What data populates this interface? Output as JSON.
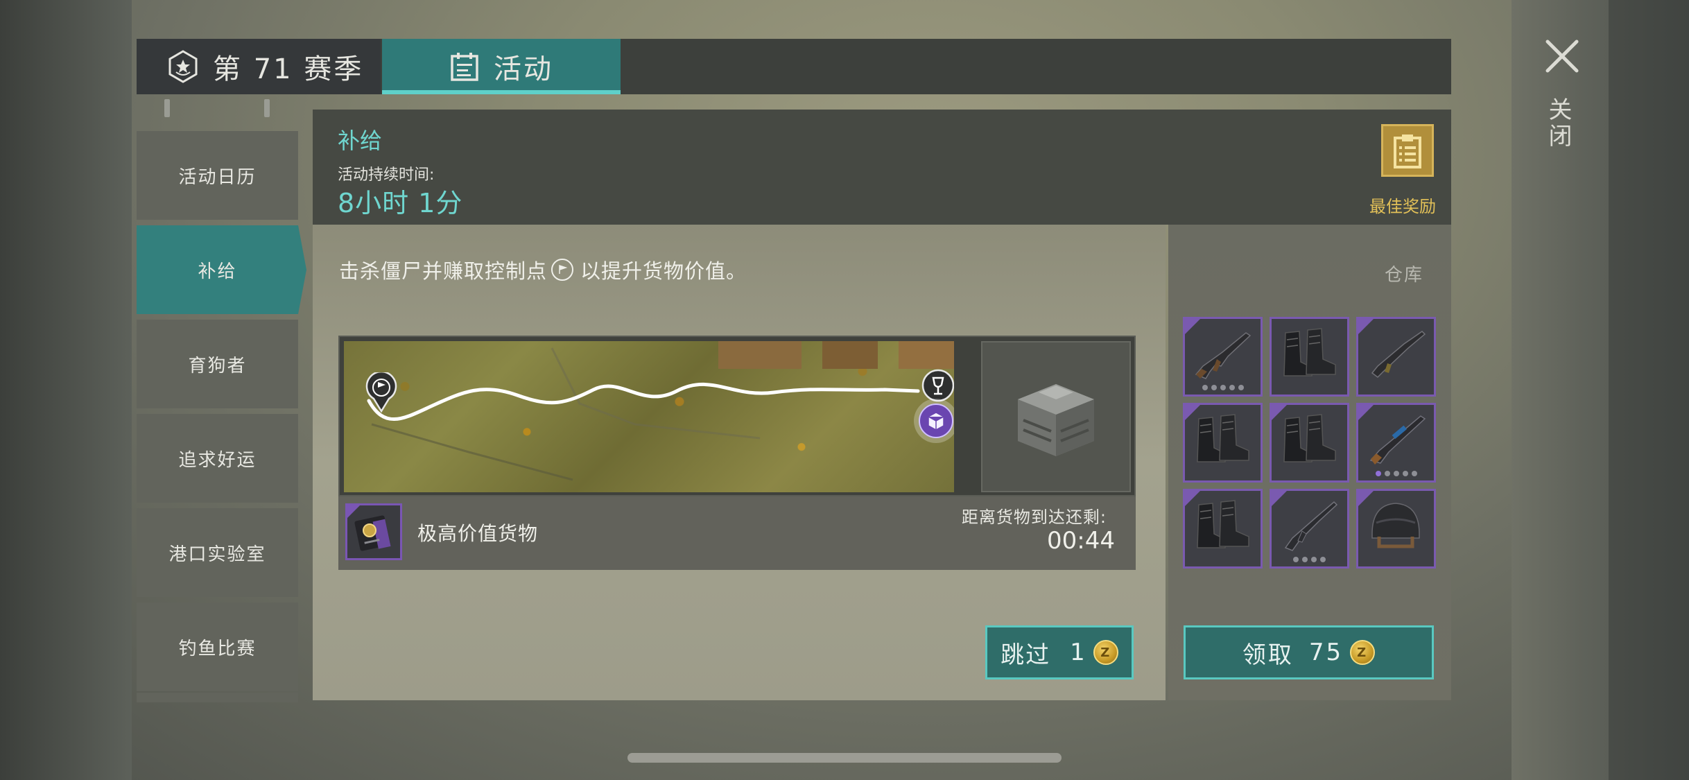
{
  "tabs": {
    "season": "第 71 赛季",
    "activity": "活动"
  },
  "sidebar": {
    "items": [
      {
        "label": "活动日历",
        "active": false
      },
      {
        "label": "补给",
        "active": true
      },
      {
        "label": "育狗者",
        "active": false
      },
      {
        "label": "追求好运",
        "active": false
      },
      {
        "label": "港口实验室",
        "active": false
      },
      {
        "label": "钓鱼比赛",
        "active": false
      }
    ]
  },
  "header": {
    "title": "补给",
    "duration_label": "活动持续时间:",
    "duration_value": "8小时 1分",
    "best_reward_label": "最佳奖励"
  },
  "instruction": {
    "before": "击杀僵尸并赚取控制点",
    "after": "以提升货物价值。"
  },
  "cargo": {
    "name": "极高价值货物",
    "eta_label": "距离货物到达还剩:",
    "eta_value": "00:44"
  },
  "skip_button": {
    "label": "跳过",
    "cost": "1",
    "coin_glyph": "Z"
  },
  "warehouse": {
    "label": "仓库",
    "items": [
      {
        "icon": "rifle-ak-icon",
        "dots": 5,
        "filled": 0
      },
      {
        "icon": "boots-icon"
      },
      {
        "icon": "shotgun-icon"
      },
      {
        "icon": "boots-icon"
      },
      {
        "icon": "boots-icon"
      },
      {
        "icon": "assault-rifle-scoped-icon",
        "dots": 5,
        "filled": 1
      },
      {
        "icon": "boots-icon"
      },
      {
        "icon": "rifle-m16-icon",
        "dots": 4,
        "filled": 0
      },
      {
        "icon": "helmet-icon"
      }
    ]
  },
  "claim_button": {
    "label": "领取",
    "cost": "75",
    "coin_glyph": "Z"
  },
  "close": {
    "label": "关闭"
  },
  "colors": {
    "accent_teal": "#33807d",
    "highlight_teal": "#6fd6cf",
    "rarity_purple": "#7a5ab0",
    "gold": "#e2c058"
  }
}
